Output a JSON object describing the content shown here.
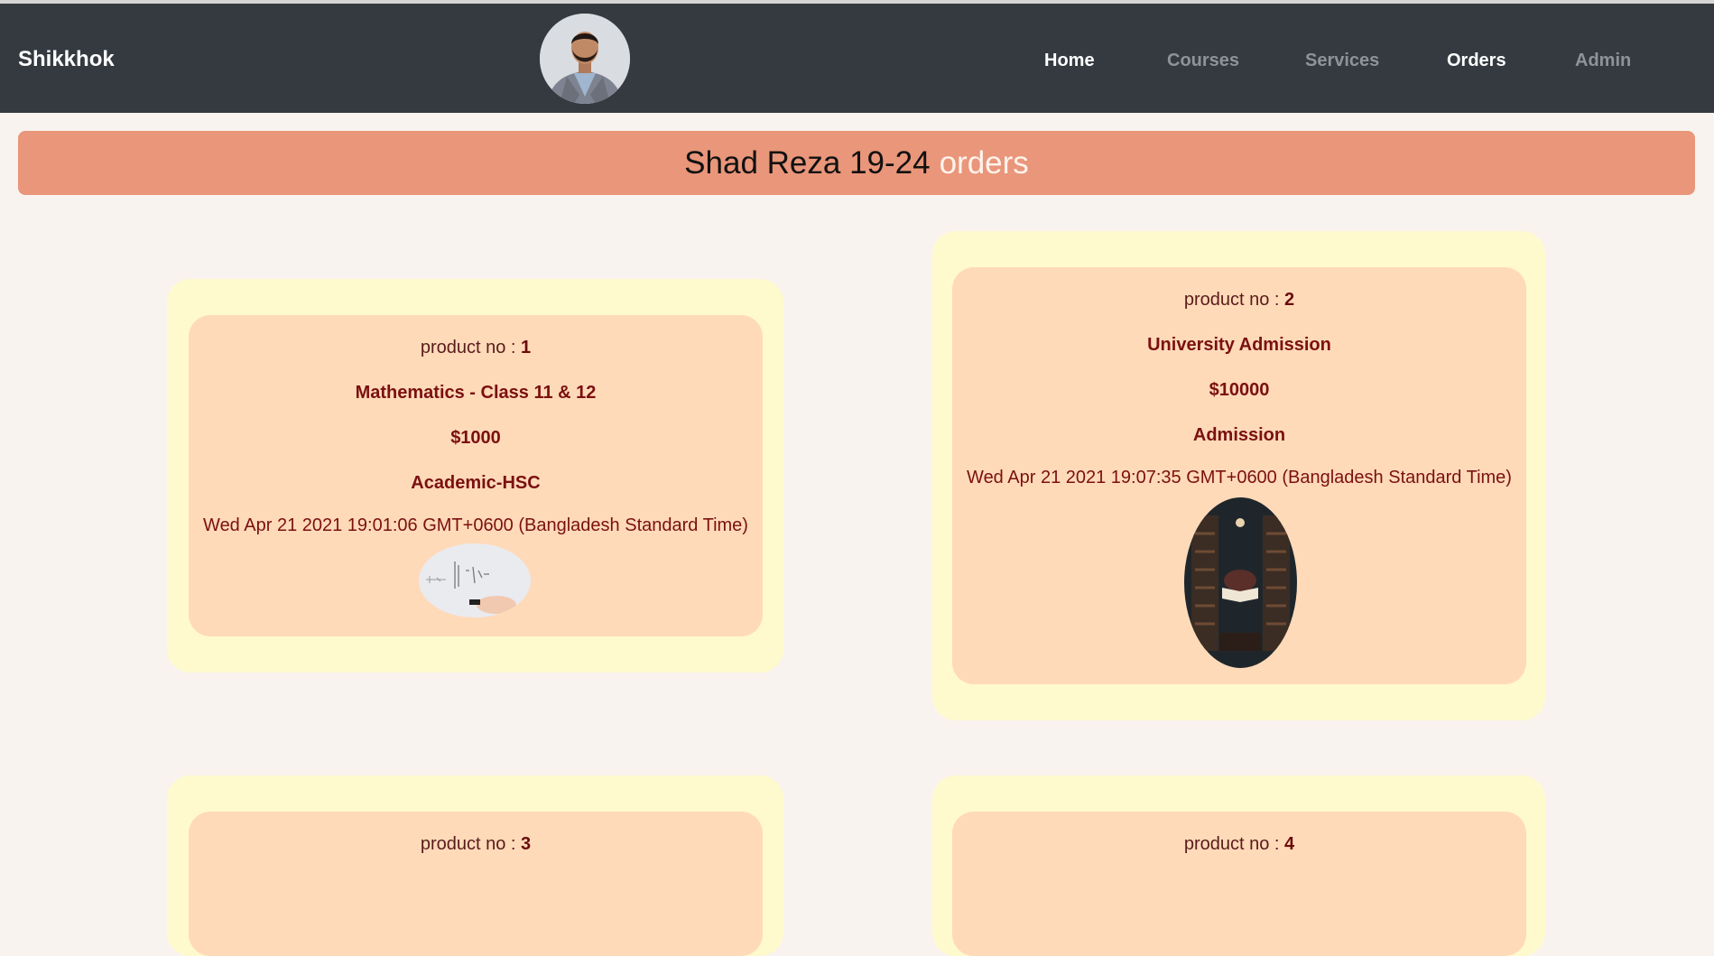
{
  "navbar": {
    "brand": "Shikkhok",
    "links": [
      "Home",
      "Courses",
      "Services",
      "Orders",
      "Admin"
    ]
  },
  "banner": {
    "name": "Shad Reza 19-24",
    "word": "orders"
  },
  "orders": [
    {
      "label": "product no :",
      "number": "1",
      "title": "Mathematics - Class 11 & 12",
      "price": "$1000",
      "category": "Academic-HSC",
      "date": "Wed Apr 21 2021 19:01:06 GMT+0600 (Bangladesh Standard Time)"
    },
    {
      "label": "product no :",
      "number": "2",
      "title": "University Admission",
      "price": "$10000",
      "category": "Admission",
      "date": "Wed Apr 21 2021 19:07:35 GMT+0600 (Bangladesh Standard Time)"
    },
    {
      "label": "product no :",
      "number": "3"
    },
    {
      "label": "product no :",
      "number": "4"
    }
  ],
  "colors": {
    "navbar": "#343a40",
    "banner": "#e9967a",
    "card_outer": "#fffacd",
    "card_inner": "#ffdab9",
    "text": "#7b1010"
  }
}
